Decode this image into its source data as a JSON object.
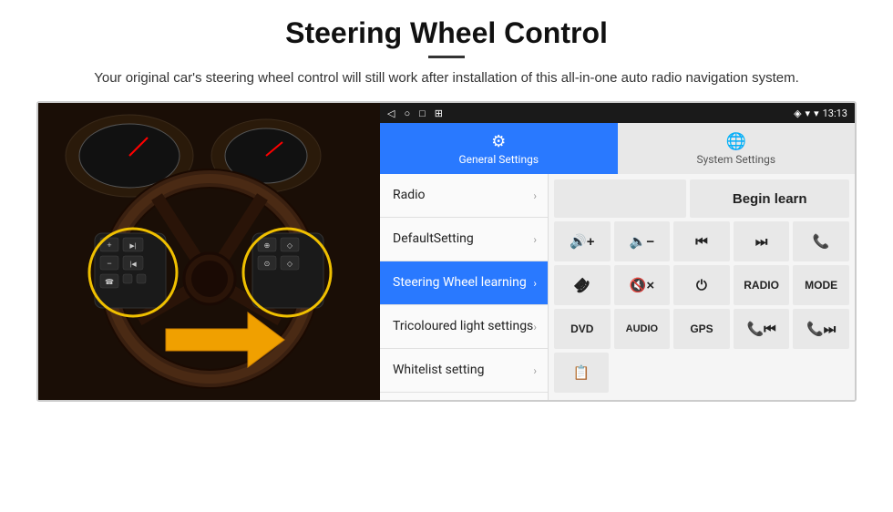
{
  "page": {
    "title": "Steering Wheel Control",
    "divider": true,
    "subtitle": "Your original car's steering wheel control will still work after installation of this all-in-one auto radio navigation system."
  },
  "status_bar": {
    "nav_back": "◁",
    "nav_home": "○",
    "nav_square": "□",
    "nav_menu": "≡",
    "time": "13:13",
    "signal": "▾▴",
    "wifi": "▾"
  },
  "tabs": [
    {
      "id": "general",
      "icon": "⚙",
      "label": "General Settings",
      "active": true
    },
    {
      "id": "system",
      "icon": "🌐",
      "label": "System Settings",
      "active": false
    }
  ],
  "menu": [
    {
      "id": "radio",
      "label": "Radio",
      "active": false
    },
    {
      "id": "default",
      "label": "DefaultSetting",
      "active": false
    },
    {
      "id": "steering",
      "label": "Steering Wheel learning",
      "active": true
    },
    {
      "id": "tricoloured",
      "label": "Tricoloured light settings",
      "active": false
    },
    {
      "id": "whitelist",
      "label": "Whitelist setting",
      "active": false
    }
  ],
  "controls": {
    "begin_learn": "Begin learn",
    "row1": [
      {
        "id": "vol-up",
        "content": "🔊+",
        "type": "icon"
      },
      {
        "id": "vol-down",
        "content": "🔈−",
        "type": "icon"
      },
      {
        "id": "prev-track",
        "content": "⏮",
        "type": "icon"
      },
      {
        "id": "next-track",
        "content": "⏭",
        "type": "icon"
      },
      {
        "id": "phone",
        "content": "📞",
        "type": "icon"
      }
    ],
    "row2": [
      {
        "id": "hang-up",
        "content": "↩",
        "type": "icon"
      },
      {
        "id": "mute",
        "content": "🔇×",
        "type": "icon"
      },
      {
        "id": "power",
        "content": "⏻",
        "type": "icon"
      },
      {
        "id": "radio-btn",
        "content": "RADIO",
        "type": "text"
      },
      {
        "id": "mode-btn",
        "content": "MODE",
        "type": "text"
      }
    ],
    "row3": [
      {
        "id": "dvd",
        "content": "DVD",
        "type": "text"
      },
      {
        "id": "audio",
        "content": "AUDIO",
        "type": "text"
      },
      {
        "id": "gps",
        "content": "GPS",
        "type": "text"
      },
      {
        "id": "tel-prev",
        "content": "📞⏮",
        "type": "icon"
      },
      {
        "id": "tel-next",
        "content": "📞⏭",
        "type": "icon"
      }
    ],
    "row4": [
      {
        "id": "list-icon",
        "content": "≡📋",
        "type": "icon"
      }
    ]
  }
}
